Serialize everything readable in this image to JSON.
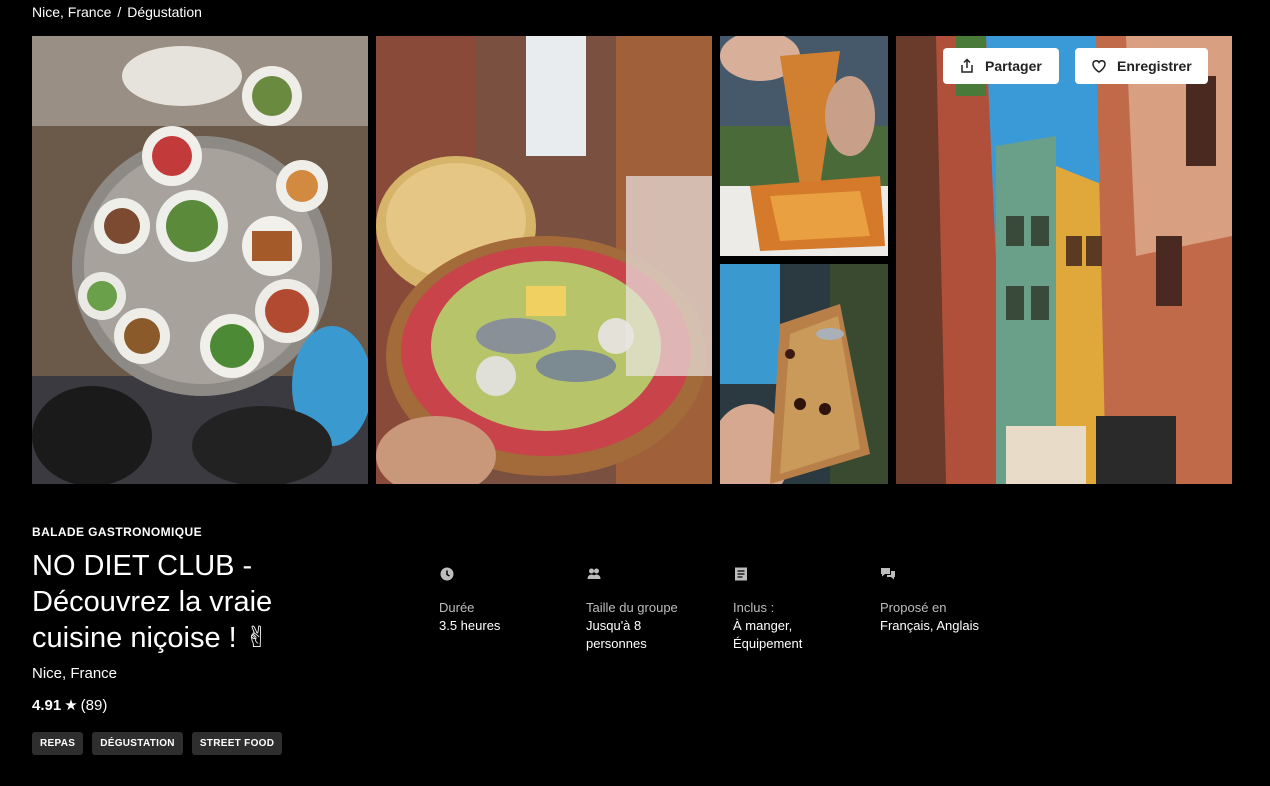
{
  "breadcrumb": {
    "city": "Nice, France",
    "separator": "/",
    "current": "Dégustation"
  },
  "gallery": {
    "photos": [
      {
        "name": "table-meal-photo"
      },
      {
        "name": "pan-bagnat-photo"
      },
      {
        "name": "socca-photo"
      },
      {
        "name": "pissaladiere-photo"
      },
      {
        "name": "old-town-street-photo"
      }
    ]
  },
  "actions": {
    "share_label": "Partager",
    "save_label": "Enregistrer"
  },
  "experience": {
    "category": "BALADE GASTRONOMIQUE",
    "title": "NO DIET CLUB - Découvrez la vraie cuisine niçoise ! ✌",
    "location": "Nice, France",
    "rating": "4.91",
    "star": "★",
    "reviews": "(89)",
    "tags": [
      "REPAS",
      "DÉGUSTATION",
      "STREET FOOD"
    ]
  },
  "details": [
    {
      "icon": "clock-icon",
      "label": "Durée",
      "value": "3.5 heures"
    },
    {
      "icon": "group-icon",
      "label": "Taille du groupe",
      "value": "Jusqu'à 8 personnes"
    },
    {
      "icon": "receipt-icon",
      "label": "Inclus :",
      "value": "À manger, Équipement"
    },
    {
      "icon": "chat-icon",
      "label": "Proposé en",
      "value": "Français, Anglais"
    }
  ],
  "colors": {
    "background": "#000000",
    "tag_bg": "#2e2e2e",
    "button_bg": "#ffffff"
  }
}
